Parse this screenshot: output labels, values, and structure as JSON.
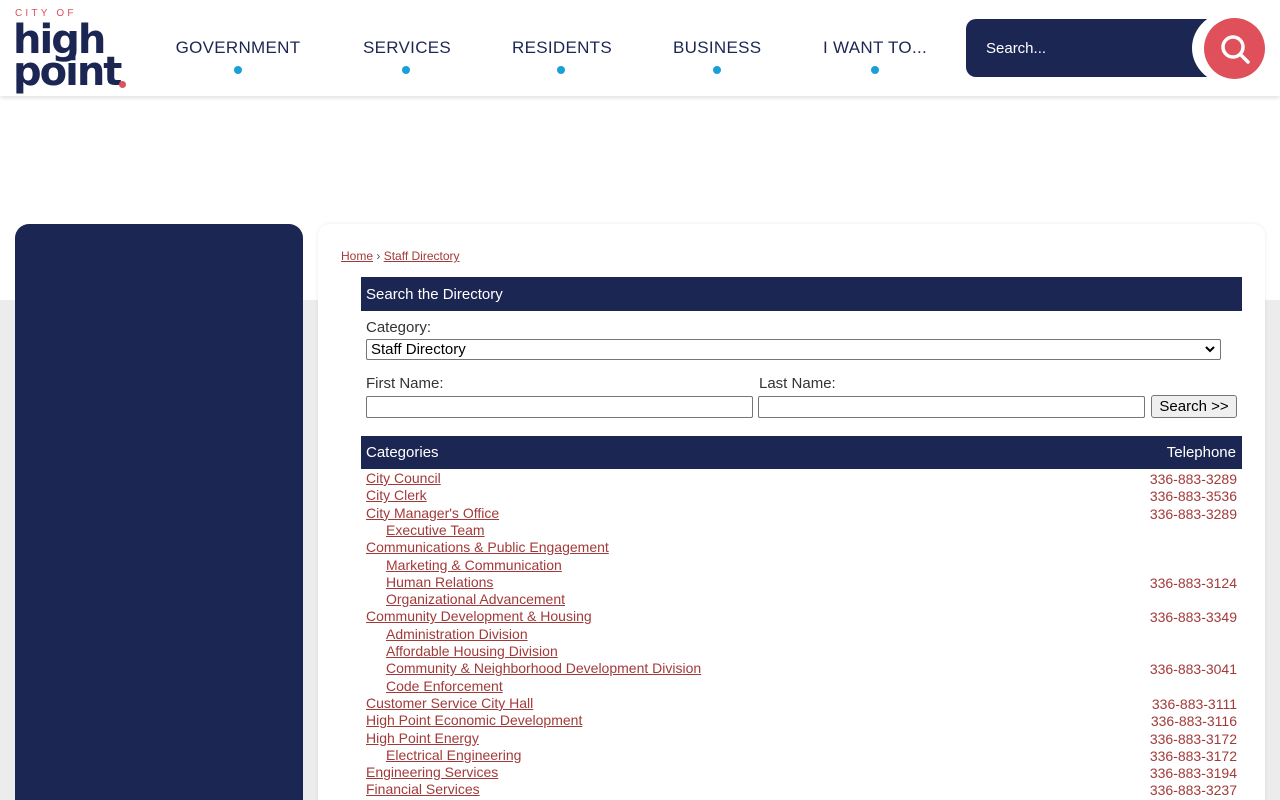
{
  "logo": {
    "city_of": "CITY OF",
    "word1": "high",
    "word2": "point"
  },
  "nav": [
    {
      "label": "GOVERNMENT"
    },
    {
      "label": "SERVICES"
    },
    {
      "label": "RESIDENTS"
    },
    {
      "label": "BUSINESS"
    },
    {
      "label": "I WANT TO..."
    }
  ],
  "search": {
    "placeholder": "Search..."
  },
  "breadcrumb": {
    "home": "Home",
    "sep": "›",
    "current": "Staff Directory"
  },
  "directory": {
    "title": "Search the Directory",
    "category_label": "Category:",
    "category_value": "Staff Directory",
    "first_name_label": "First Name:",
    "last_name_label": "Last Name:",
    "search_button": "Search >>"
  },
  "table": {
    "col_categories": "Categories",
    "col_telephone": "Telephone",
    "rows": [
      {
        "name": "City Council",
        "phone": "336-883-3289",
        "sub": false
      },
      {
        "name": "City Clerk",
        "phone": "336-883-3536",
        "sub": false
      },
      {
        "name": "City Manager's Office",
        "phone": "336-883-3289",
        "sub": false
      },
      {
        "name": "Executive Team",
        "phone": "",
        "sub": true
      },
      {
        "name": "Communications & Public Engagement",
        "phone": "",
        "sub": false
      },
      {
        "name": "Marketing & Communication",
        "phone": "",
        "sub": true
      },
      {
        "name": "Human Relations",
        "phone": "336-883-3124",
        "sub": true
      },
      {
        "name": "Organizational Advancement",
        "phone": "",
        "sub": true
      },
      {
        "name": "Community Development & Housing",
        "phone": "336-883-3349",
        "sub": false
      },
      {
        "name": "Administration Division",
        "phone": "",
        "sub": true
      },
      {
        "name": "Affordable Housing Division",
        "phone": "",
        "sub": true
      },
      {
        "name": "Community & Neighborhood Development Division",
        "phone": "336-883-3041",
        "sub": true
      },
      {
        "name": "Code Enforcement",
        "phone": "",
        "sub": true
      },
      {
        "name": "Customer Service City Hall",
        "phone": "336-883-3111",
        "sub": false
      },
      {
        "name": "High Point Economic Development",
        "phone": "336-883-3116",
        "sub": false
      },
      {
        "name": "High Point Energy",
        "phone": "336-883-3172",
        "sub": false
      },
      {
        "name": "Electrical Engineering",
        "phone": "336-883-3172",
        "sub": true
      },
      {
        "name": "Engineering Services",
        "phone": "336-883-3194",
        "sub": false
      },
      {
        "name": "Financial Services",
        "phone": "336-883-3237",
        "sub": false
      }
    ]
  },
  "colors": {
    "navy": "#1b2653",
    "accent_red": "#e0505a",
    "link": "#a33a3a",
    "nav_dot": "#1aa0d8"
  }
}
